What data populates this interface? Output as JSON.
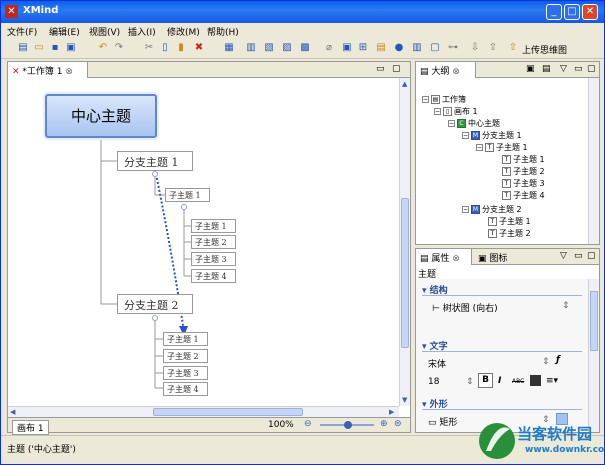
{
  "window": {
    "title": "XMind",
    "app_icon": "xmind-logo-icon"
  },
  "menu": [
    "文件(F)",
    "编辑(E)",
    "视图(V)",
    "插入(I)",
    "修改(M)",
    "帮助(H)"
  ],
  "toolbar": {
    "upload_label": "上传思维图"
  },
  "editor": {
    "tab_label": "*工作簿 1",
    "sheet_tab": "画布 1",
    "zoom": "100%"
  },
  "mindmap": {
    "central": "中心主题",
    "branches": [
      {
        "label": "分支主题 1",
        "child": "子主题 1",
        "subtopics": [
          "子主题 1",
          "子主题 2",
          "子主题 3",
          "子主题 4"
        ]
      },
      {
        "label": "分支主题 2",
        "subtopics": [
          "子主题 1",
          "子主题 2",
          "子主题 3",
          "子主题 4"
        ]
      }
    ]
  },
  "outline": {
    "tab_label": "大纲",
    "rows": [
      {
        "icon": "workbook-icon",
        "text": "工作簿"
      },
      {
        "icon": "sheet-icon",
        "text": "画布 1"
      },
      {
        "icon": "central-topic-icon",
        "text": "中心主题"
      },
      {
        "icon": "main-topic-icon",
        "text": "分支主题 1"
      },
      {
        "icon": "topic-icon",
        "text": "子主题 1"
      },
      {
        "icon": "topic-icon",
        "text": "子主题 1"
      },
      {
        "icon": "topic-icon",
        "text": "子主题 2"
      },
      {
        "icon": "topic-icon",
        "text": "子主题 3"
      },
      {
        "icon": "topic-icon",
        "text": "子主题 4"
      },
      {
        "icon": "main-topic-icon",
        "text": "分支主题 2"
      },
      {
        "icon": "topic-icon",
        "text": "子主题 1"
      },
      {
        "icon": "topic-icon",
        "text": "子主题 2"
      }
    ]
  },
  "properties": {
    "tab_label": "属性",
    "icons_tab_label": "图标",
    "subject": "主题",
    "structure": {
      "heading": "结构",
      "value": "树状图 (向右)"
    },
    "text": {
      "heading": "文字",
      "font": "宋体",
      "size": "18",
      "bold": "B",
      "italic": "I",
      "strike": "ABC"
    },
    "shape": {
      "heading": "外形",
      "value": "矩形"
    }
  },
  "status": "主题 ('中心主题')",
  "watermark": {
    "brand": "当客软件园",
    "url": "www.downkr.com"
  }
}
